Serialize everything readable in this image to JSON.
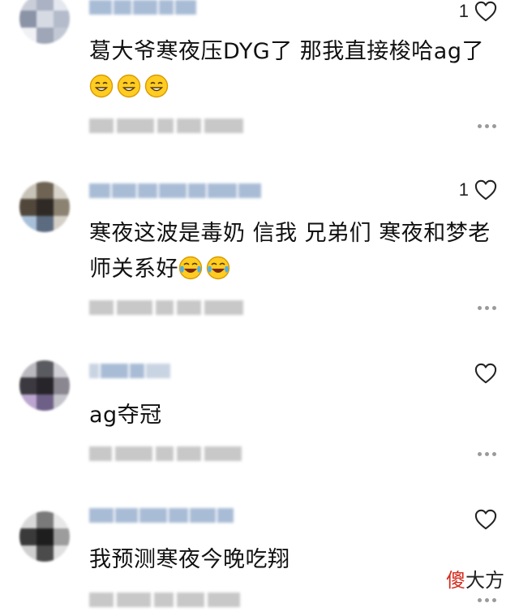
{
  "comments": [
    {
      "likes": "1",
      "text": "葛大爷寒夜压DYG了 那我直接梭哈ag了",
      "emoji": [
        "smile-emoji",
        "smile-emoji",
        "smile-emoji"
      ],
      "avatar_palette": [
        "#c9ced8",
        "#aab2c3",
        "#e4e7ee",
        "#8b93a6",
        "#d6dae3",
        "#b4bccb",
        "#f0f1f5",
        "#9ea6b7",
        "#c2c8d4"
      ]
    },
    {
      "likes": "1",
      "text": "寒夜这波是毒奶 信我 兄弟们 寒夜和梦老师关系好",
      "emoji": [
        "tears-of-joy-emoji",
        "tears-of-joy-emoji"
      ],
      "avatar_palette": [
        "#c8c3b8",
        "#6f6454",
        "#d8d4cc",
        "#51473a",
        "#2f2a25",
        "#8b8272",
        "#a7c0d8",
        "#5c6b80",
        "#d4cfc6"
      ]
    },
    {
      "likes": "",
      "text": "ag夺冠",
      "emoji": [],
      "avatar_palette": [
        "#b9b9bf",
        "#5a5a61",
        "#d0d0d6",
        "#3c3a40",
        "#27252a",
        "#8a8790",
        "#bba6cf",
        "#6d5f86",
        "#c4c3ca"
      ]
    },
    {
      "likes": "",
      "text": "我预测寒夜今晚吃翔",
      "emoji": [],
      "avatar_palette": [
        "#d9d9d9",
        "#7a7a7a",
        "#e8e8e8",
        "#3a3a3a",
        "#1e1e1e",
        "#9c9c9c",
        "#cfcfcf",
        "#4b4b4b",
        "#e0e0e0"
      ]
    }
  ],
  "watermark": {
    "part1": "傻",
    "part2": "大方"
  },
  "colors": {
    "text": "#111111",
    "blurred_name": "#a9bcd6",
    "blurred_meta": "#c8c8c8",
    "watermark_red": "#d42a1c"
  }
}
